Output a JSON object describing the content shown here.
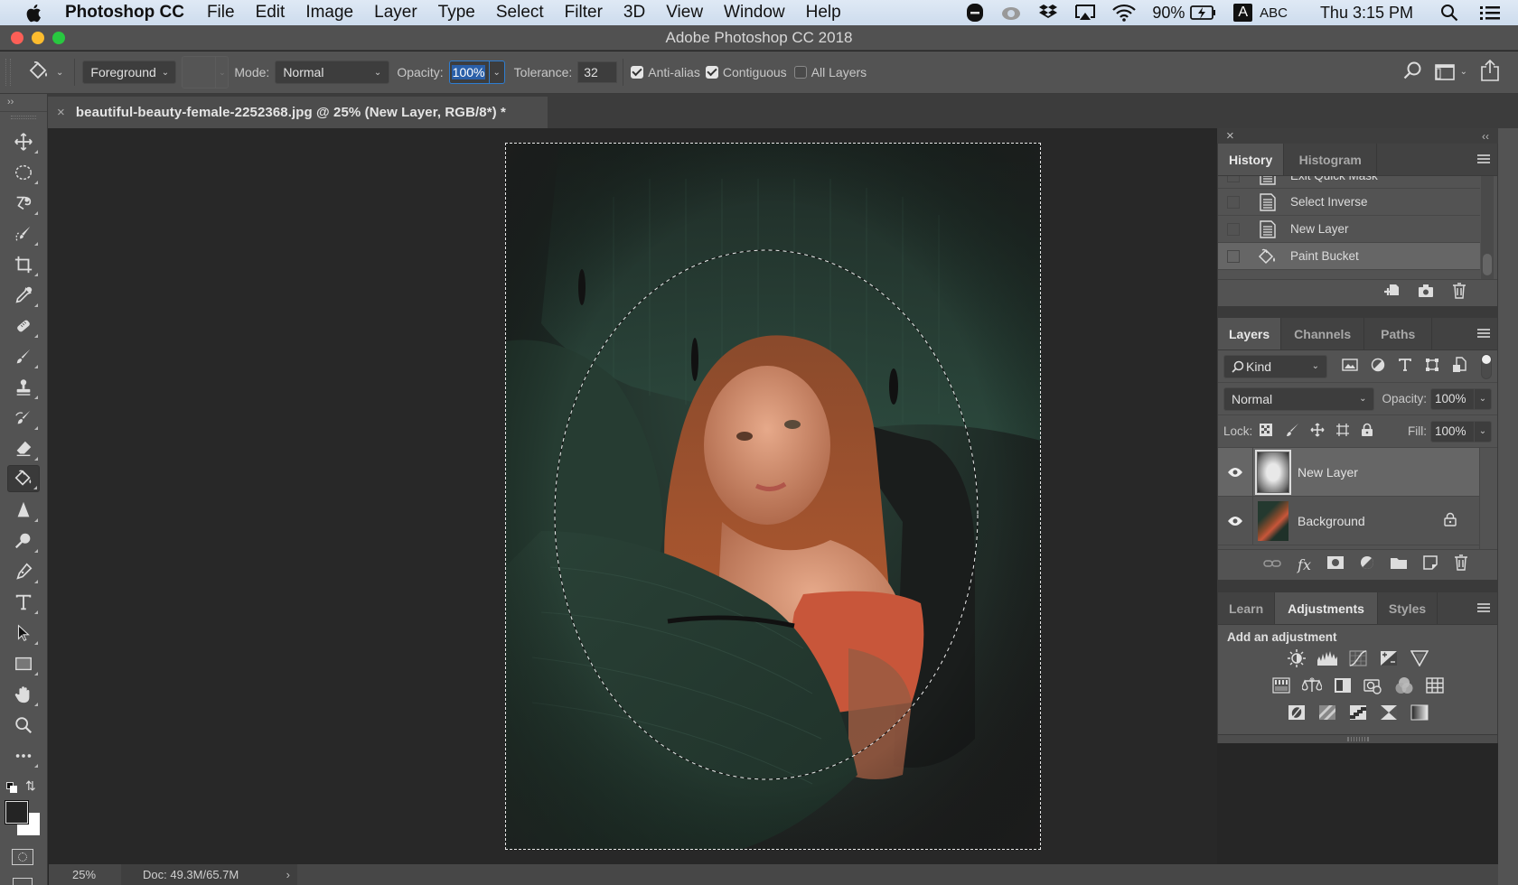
{
  "menubar": {
    "app_name": "Photoshop CC",
    "items": [
      "File",
      "Edit",
      "Image",
      "Layer",
      "Type",
      "Select",
      "Filter",
      "3D",
      "View",
      "Window",
      "Help"
    ],
    "status": {
      "battery": "90%",
      "input_source": "ABC",
      "input_badge": "A",
      "clock": "Thu 3:15 PM"
    },
    "status_icons": [
      "skype-icon",
      "creative-cloud-icon",
      "dropbox-icon",
      "airplay-icon",
      "wifi-icon",
      "battery-charging-icon",
      "input-source-icon",
      "spotlight-icon",
      "notification-center-icon"
    ]
  },
  "window": {
    "title": "Adobe Photoshop CC 2018"
  },
  "options_bar": {
    "tool_icon": "paint-bucket-icon",
    "fill_source": "Foreground",
    "mode_label": "Mode:",
    "mode_value": "Normal",
    "opacity_label": "Opacity:",
    "opacity_value": "100%",
    "tolerance_label": "Tolerance:",
    "tolerance_value": "32",
    "anti_alias_label": "Anti-alias",
    "anti_alias_checked": true,
    "contiguous_label": "Contiguous",
    "contiguous_checked": true,
    "all_layers_label": "All Layers",
    "all_layers_checked": false
  },
  "document": {
    "tab_title": "beautiful-beauty-female-2252368.jpg @ 25% (New Layer, RGB/8*) *",
    "close_glyph": "×"
  },
  "toolbar": {
    "collapse_glyph": "››",
    "tools": [
      "move",
      "elliptical-marquee",
      "magnetic-lasso",
      "quick-selection",
      "crop",
      "eyedropper",
      "spot-healing-brush",
      "brush",
      "clone-stamp",
      "history-brush",
      "eraser",
      "paint-bucket",
      "sharpen",
      "dodge",
      "pen",
      "type",
      "path-selection",
      "rectangle",
      "hand",
      "zoom",
      "edit-toolbar"
    ],
    "active_tool": "paint-bucket",
    "foreground_color": "#242424",
    "background_color": "#ffffff"
  },
  "status_bar": {
    "zoom": "25%",
    "doc_info": "Doc: 49.3M/65.7M",
    "arrow": "›"
  },
  "panels": {
    "collapse_glyph": "‹‹",
    "close_glyph": "×",
    "history": {
      "tabs": [
        "History",
        "Histogram"
      ],
      "active_tab": "History",
      "items": [
        {
          "label": "Exit Quick Mask",
          "icon": "document-icon"
        },
        {
          "label": "Select Inverse",
          "icon": "document-icon"
        },
        {
          "label": "New Layer",
          "icon": "document-icon"
        },
        {
          "label": "Paint Bucket",
          "icon": "paint-bucket-icon",
          "selected": true
        }
      ]
    },
    "layers": {
      "tabs": [
        "Layers",
        "Channels",
        "Paths"
      ],
      "active_tab": "Layers",
      "filter_kind": "Kind",
      "blend_mode": "Normal",
      "opacity_label": "Opacity:",
      "opacity_value": "100%",
      "lock_label": "Lock:",
      "fill_label": "Fill:",
      "fill_value": "100%",
      "items": [
        {
          "name": "New Layer",
          "visible": true,
          "selected": true,
          "locked": false
        },
        {
          "name": "Background",
          "visible": true,
          "selected": false,
          "locked": true
        }
      ]
    },
    "adjustments": {
      "tabs": [
        "Learn",
        "Adjustments",
        "Styles"
      ],
      "active_tab": "Adjustments",
      "heading": "Add an adjustment",
      "rows": [
        [
          "brightness-contrast",
          "levels",
          "curves",
          "exposure",
          "vibrance"
        ],
        [
          "hue-saturation",
          "color-balance",
          "black-white",
          "photo-filter",
          "channel-mixer",
          "color-lookup"
        ],
        [
          "invert",
          "posterize",
          "threshold",
          "selective-color",
          "gradient-map"
        ]
      ]
    }
  }
}
